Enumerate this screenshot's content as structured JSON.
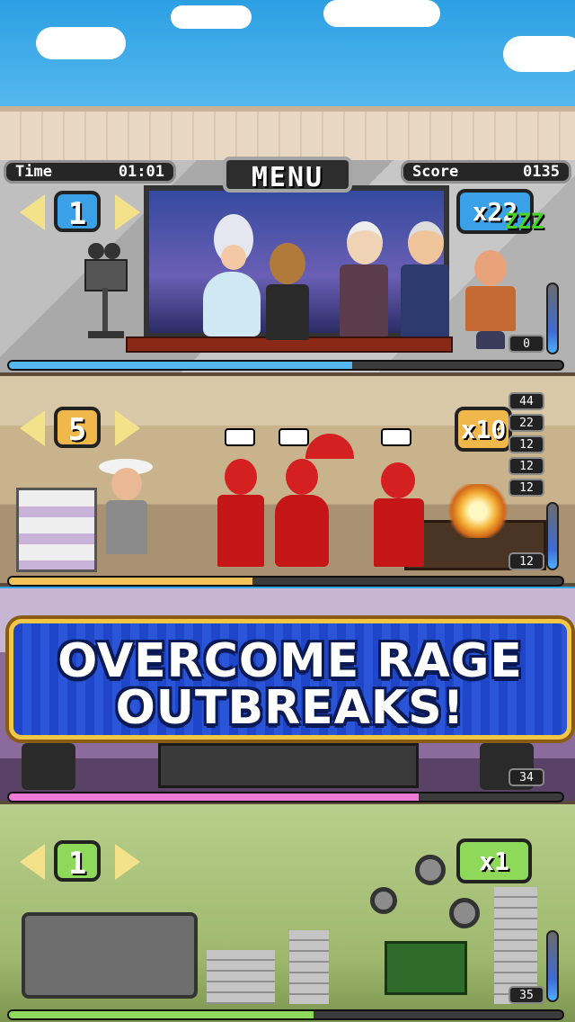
{
  "hud": {
    "time_label": "Time",
    "time_value": "01:01",
    "menu_label": "MENU",
    "score_label": "Score",
    "score_value": "0135"
  },
  "floors": [
    {
      "level": "1",
      "multiplier": "x22",
      "sleep": "ZZZ",
      "counter": "0",
      "progress": 0.62,
      "level_color": "#3aa0e8",
      "mult_color": "#3aa0e8"
    },
    {
      "level": "5",
      "multiplier": "x10",
      "counters": [
        "44",
        "22",
        "12",
        "12",
        "12"
      ],
      "counter": "12",
      "progress": 0.44,
      "level_color": "#f0b84a",
      "mult_color": "#f0b84a"
    },
    {
      "counter": "34",
      "progress": 0.74,
      "bar_color": "#f07ad8"
    },
    {
      "level": "1",
      "multiplier": "x1",
      "counter": "35",
      "progress": 0.55,
      "level_color": "#8ed85a",
      "mult_color": "#8ed85a"
    }
  ],
  "banner": {
    "line1": "OVERCOME RAGE",
    "line2": "OUTBREAKS!"
  },
  "icons": [
    "arrow-left-icon",
    "arrow-right-icon",
    "movie-camera-icon",
    "umbrella-icon",
    "explosion-icon",
    "speaker-icon",
    "film-reel-icon"
  ]
}
